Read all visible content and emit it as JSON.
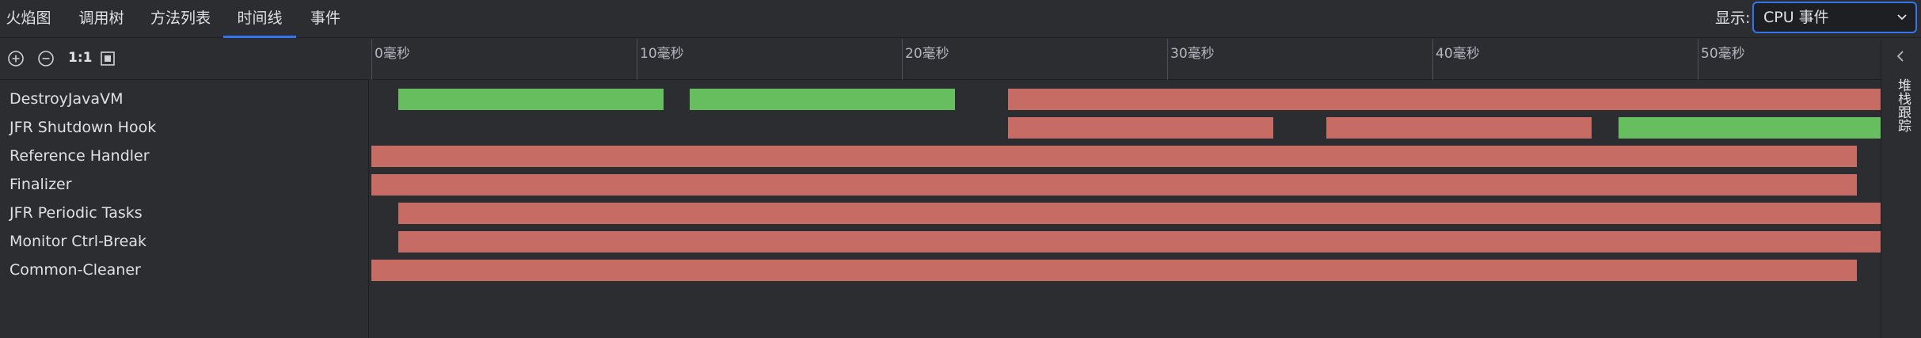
{
  "tabs": [
    {
      "label": "火焰图",
      "active": false
    },
    {
      "label": "调用树",
      "active": false
    },
    {
      "label": "方法列表",
      "active": false
    },
    {
      "label": "时间线",
      "active": true
    },
    {
      "label": "事件",
      "active": false
    }
  ],
  "display": {
    "label": "显示:",
    "selected": "CPU 事件"
  },
  "toolbar": {
    "zoom_in_icon": "plus-circle-icon",
    "zoom_out_icon": "minus-circle-icon",
    "actual_size_label": "1:1",
    "fit_icon": "fit-frame-icon"
  },
  "ruler": {
    "ticks": [
      {
        "ms": 0,
        "label": "0毫秒"
      },
      {
        "ms": 10,
        "label": "10毫秒"
      },
      {
        "ms": 20,
        "label": "20毫秒"
      },
      {
        "ms": 30,
        "label": "30毫秒"
      },
      {
        "ms": 40,
        "label": "40毫秒"
      },
      {
        "ms": 50,
        "label": "50毫秒"
      }
    ]
  },
  "side_panel": {
    "label": "堆栈跟踪",
    "collapse_icon": "chevron-left-icon"
  },
  "colors": {
    "cpu": "#c66c64",
    "other": "#66be5e",
    "accent": "#3574f0"
  },
  "threads": [
    {
      "name": "DestroyJavaVM",
      "segments": [
        {
          "start": 1.0,
          "end": 11.0,
          "type": "other"
        },
        {
          "start": 12.0,
          "end": 22.0,
          "type": "other"
        },
        {
          "start": 24.0,
          "end": 57.0,
          "type": "cpu"
        }
      ]
    },
    {
      "name": "JFR Shutdown Hook",
      "segments": [
        {
          "start": 24.0,
          "end": 34.0,
          "type": "cpu"
        },
        {
          "start": 36.0,
          "end": 46.0,
          "type": "cpu"
        },
        {
          "start": 47.0,
          "end": 57.0,
          "type": "other"
        }
      ]
    },
    {
      "name": "Reference Handler",
      "segments": [
        {
          "start": 0.0,
          "end": 56.0,
          "type": "cpu"
        }
      ]
    },
    {
      "name": "Finalizer",
      "segments": [
        {
          "start": 0.0,
          "end": 56.0,
          "type": "cpu"
        }
      ]
    },
    {
      "name": "JFR Periodic Tasks",
      "segments": [
        {
          "start": 1.0,
          "end": 57.0,
          "type": "cpu"
        }
      ]
    },
    {
      "name": "Monitor Ctrl-Break",
      "segments": [
        {
          "start": 1.0,
          "end": 57.0,
          "type": "cpu"
        }
      ]
    },
    {
      "name": "Common-Cleaner",
      "segments": [
        {
          "start": 0.0,
          "end": 56.0,
          "type": "cpu"
        }
      ]
    }
  ]
}
